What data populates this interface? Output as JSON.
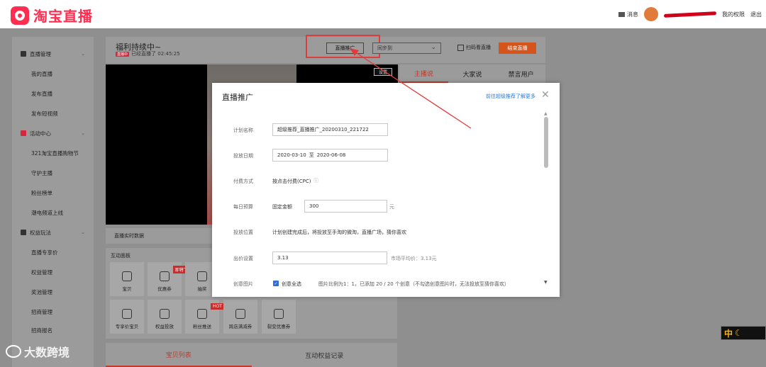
{
  "header": {
    "logo_text": "淘宝直播",
    "messages_label": "消息",
    "permissions_label": "我的权限",
    "logout_label": "退出"
  },
  "sidebar": {
    "items": [
      {
        "label": "直播管理",
        "kind": "group",
        "icon": "monitor-icon"
      },
      {
        "label": "我的直播",
        "kind": "sub"
      },
      {
        "label": "发布直播",
        "kind": "sub"
      },
      {
        "label": "发布短视频",
        "kind": "sub"
      },
      {
        "label": "活动中心",
        "kind": "group",
        "icon": "activity-icon"
      },
      {
        "label": "321淘宝直播购物节",
        "kind": "sub"
      },
      {
        "label": "守护主播",
        "kind": "sub"
      },
      {
        "label": "粉丝榜单",
        "kind": "sub"
      },
      {
        "label": "潮电频道上线",
        "kind": "sub"
      },
      {
        "label": "权益玩法",
        "kind": "group",
        "icon": "rights-icon"
      },
      {
        "label": "直播专享价",
        "kind": "sub"
      },
      {
        "label": "权益管理",
        "kind": "sub"
      },
      {
        "label": "奖池管理",
        "kind": "sub"
      },
      {
        "label": "招商管理",
        "kind": "sub"
      },
      {
        "label": "招商报名",
        "kind": "sub"
      }
    ]
  },
  "live": {
    "title": "福利持续中~",
    "badge": "直播中",
    "elapsed": "已经直播了 02:45:25",
    "promote_button": "直播推广",
    "sync_placeholder": "同步到",
    "watch_label": "扫码看直播",
    "end_button": "结束直播",
    "settings_button": "设置",
    "realtime_label": "直播实时数据"
  },
  "right_tabs": [
    "主播说",
    "大家说",
    "禁言用户"
  ],
  "interaction": {
    "title": "互动面板",
    "tools": [
      {
        "label": "宝贝",
        "icon": "tag-icon"
      },
      {
        "label": "优惠券",
        "icon": "coupon-icon",
        "tag": "即将下线"
      },
      {
        "label": "抽奖",
        "icon": "gift-icon"
      },
      {
        "label": "专享价宝贝",
        "icon": "tag-icon"
      },
      {
        "label": "权益投放",
        "icon": "rights-box-icon"
      },
      {
        "label": "粉丝推送",
        "icon": "chat-icon",
        "tag": "HOT"
      },
      {
        "label": "跨店满减券",
        "icon": "rights-box-icon"
      },
      {
        "label": "裂变优惠券",
        "icon": "share-icon"
      }
    ]
  },
  "bottom_tabs": [
    "宝贝列表",
    "互动权益记录"
  ],
  "watermark": "大数跨境",
  "ime": "中",
  "modal": {
    "title": "直播推广",
    "link": "前往超级推荐了解更多",
    "plan_name_label": "计划名称",
    "plan_name_value": "超级推荐_直播推广_20200310_221722",
    "dates_label": "投放日期",
    "date_start": "2020-03-10",
    "date_sep": "至",
    "date_end": "2020-06-08",
    "pay_label": "付费方式",
    "pay_value": "按点击付费(CPC)",
    "budget_label": "每日预算",
    "budget_type": "固定金额",
    "budget_value": "300",
    "budget_unit": "元",
    "position_label": "投放位置",
    "position_value": "计划创建完成后，将投放至手淘的微淘，直播广场，猜你喜欢",
    "bid_label": "出价设置",
    "bid_value": "3.13",
    "bid_hint": "市场平均价：3.13元",
    "creative_label": "创意图片",
    "creative_checkbox": "创意全选",
    "creative_hint": "图片比例为1：1，已添加 20 / 20 个创意（不勾选创意图片时，无法投放至猜你喜欢）"
  },
  "colors": {
    "brand": "#ff2d4f",
    "end_button": "#d4541c",
    "annotation": "#e23b3b",
    "link": "#2d7ad6"
  }
}
